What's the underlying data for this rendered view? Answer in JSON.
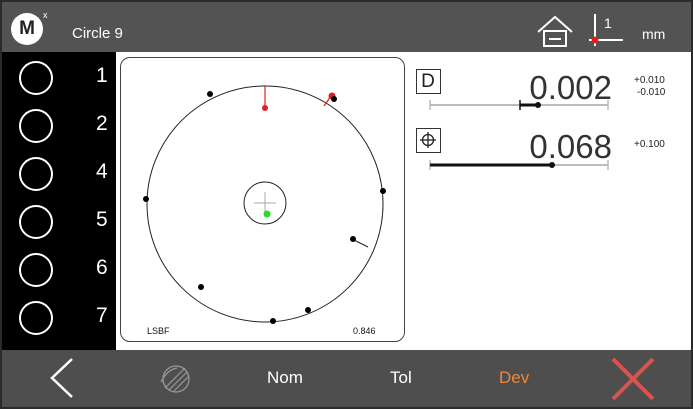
{
  "header": {
    "logo_text": "M",
    "logo_superscript": "x",
    "title": "Circle 9",
    "axis_number": "1",
    "unit": "mm"
  },
  "points": [
    {
      "label": "1"
    },
    {
      "label": "2"
    },
    {
      "label": "4"
    },
    {
      "label": "5"
    },
    {
      "label": "6"
    },
    {
      "label": "7"
    }
  ],
  "plot": {
    "fit_method": "LSBF",
    "fit_value": "0.846",
    "colors": {
      "deviation_marker": "#e02020",
      "center_marker": "#22dd22",
      "points": "#000000"
    }
  },
  "measurements": {
    "diameter": {
      "icon": "D",
      "value": "0.002",
      "tol_upper": "+0.010",
      "tol_lower": "-0.010",
      "icon_name": "diameter-icon"
    },
    "position": {
      "icon": "position-icon",
      "value": "0.068",
      "tol_upper": "+0.100"
    }
  },
  "footer": {
    "tab_nom": "Nom",
    "tab_tol": "Tol",
    "tab_dev": "Dev",
    "active_tab": "Dev",
    "active_color": "#f0863c",
    "cancel_color": "#d9534f"
  }
}
